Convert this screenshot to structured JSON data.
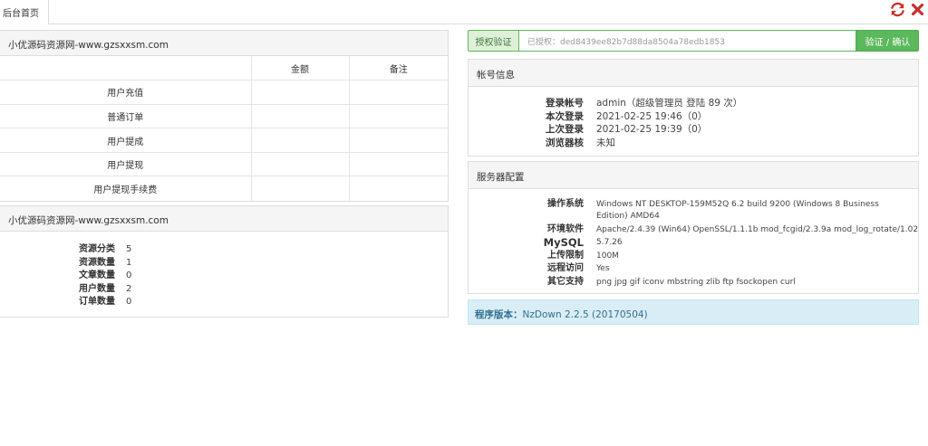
{
  "tabs": [
    {
      "label": "后台首页"
    }
  ],
  "finance": {
    "title": "小优源码资源网-www.gzsxxsm.com",
    "headers": [
      "",
      "金额",
      "备注"
    ],
    "rows": [
      {
        "label": "用户充值",
        "amount": "",
        "note": ""
      },
      {
        "label": "普通订单",
        "amount": "",
        "note": ""
      },
      {
        "label": "用户提成",
        "amount": "",
        "note": ""
      },
      {
        "label": "用户提现",
        "amount": "",
        "note": ""
      },
      {
        "label": "用户提现手续费",
        "amount": "",
        "note": ""
      }
    ]
  },
  "stats": {
    "title": "小优源码资源网-www.gzsxxsm.com",
    "items": [
      {
        "label": "资源分类",
        "value": "5"
      },
      {
        "label": "资源数量",
        "value": "1"
      },
      {
        "label": "文章数量",
        "value": "0"
      },
      {
        "label": "用户数量",
        "value": "2"
      },
      {
        "label": "订单数量",
        "value": "0"
      }
    ]
  },
  "auth": {
    "label": "授权验证",
    "value": "已授权：ded8439ee82b7d88da8504a78edb1853",
    "button": "验证 / 确认"
  },
  "account": {
    "title": "帐号信息",
    "items": [
      {
        "label": "登录帐号",
        "value": "admin（超级管理员 登陆 89 次）"
      },
      {
        "label": "本次登录",
        "value": "2021-02-25 19:46（0）"
      },
      {
        "label": "上次登录",
        "value": "2021-02-25 19:39（0）"
      },
      {
        "label": "浏览器核",
        "value": "未知"
      }
    ]
  },
  "server": {
    "title": "服务器配置",
    "items": [
      {
        "label": "操作系统",
        "value": "Windows NT DESKTOP-159M52Q 6.2 build 9200 (Windows 8 Business Edition) AMD64"
      },
      {
        "label": "环境软件",
        "value": "Apache/2.4.39 (Win64) OpenSSL/1.1.1b mod_fcgid/2.3.9a mod_log_rotate/1.02"
      },
      {
        "label": "MySQL",
        "value": "5.7.26"
      },
      {
        "label": "上传限制",
        "value": "100M"
      },
      {
        "label": "远程访问",
        "value": "Yes"
      },
      {
        "label": "其它支持",
        "value": "png jpg gif iconv mbstring zlib ftp fsockopen curl"
      }
    ]
  },
  "version": {
    "label": "程序版本：",
    "value": "NzDown 2.2.5 (20170504)"
  },
  "colors": {
    "refresh_icon": "#c9302c",
    "close_icon": "#c9302c",
    "success": "#5cb85c",
    "info_bg": "#d9edf7"
  },
  "icons": [
    "refresh-icon",
    "close-icon"
  ]
}
